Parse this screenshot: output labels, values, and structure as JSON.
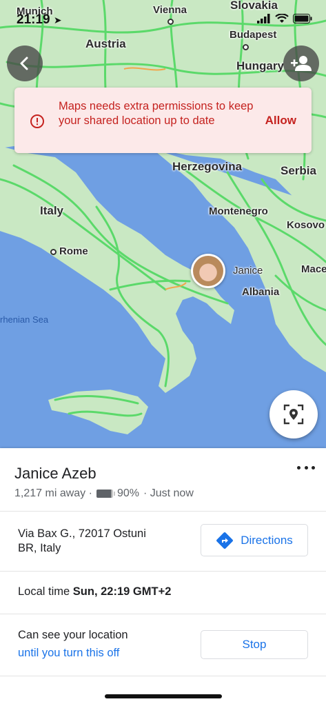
{
  "status_bar": {
    "time": "21:19",
    "location_arrow": "location-arrow-icon",
    "icons": [
      "signal-icon",
      "wifi-icon",
      "battery-icon"
    ]
  },
  "map": {
    "labels": {
      "munich": "Munich",
      "vienna": "Vienna",
      "slovakia": "Slovakia",
      "austria": "Austria",
      "budapest": "Budapest",
      "hungary": "Hungary",
      "herzegovina": "Herzegovina",
      "serbia": "Serbia",
      "italy": "Italy",
      "montenegro": "Montenegro",
      "kosovo": "Kosovo",
      "rome": "Rome",
      "janice": "Janice",
      "mace": "Mace",
      "albania": "Albania",
      "tyrrhenian_sea": "rhenian Sea"
    },
    "colors": {
      "sea": "#6f9fe3",
      "land": "#c9e8c3",
      "roads": "#5bd96a"
    }
  },
  "permission_banner": {
    "icon": "info-icon",
    "message": "Maps needs extra permissions to keep your shared location up to date",
    "action": "Allow"
  },
  "controls": {
    "back_icon": "chevron-left-icon",
    "add_person_icon": "add-person-icon",
    "locate_icon": "location-target-icon"
  },
  "person": {
    "name": "Janice Azeb",
    "distance": "1,217 mi away ·",
    "battery_percent": "90%",
    "battery_level": 0.9,
    "updated": "· Just now"
  },
  "address": {
    "line1": "Via Bax G., 72017 Ostuni",
    "line2": "BR, Italy"
  },
  "directions": {
    "label": "Directions",
    "icon": "directions-icon"
  },
  "local_time": {
    "prefix": "Local time",
    "value": "Sun, 22:19 GMT+2"
  },
  "sharing": {
    "label": "Can see your location",
    "until": "until you turn this off",
    "stop_label": "Stop"
  }
}
